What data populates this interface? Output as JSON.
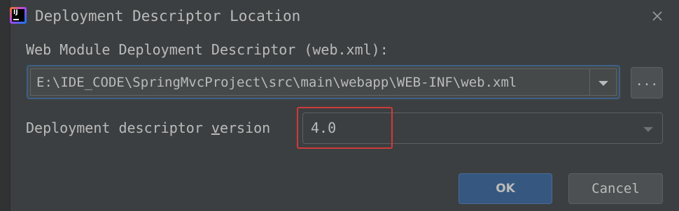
{
  "window": {
    "title": "Deployment Descriptor Location",
    "app_icon_text": "IJ"
  },
  "descriptor": {
    "label": "Web Module Deployment Descriptor (web.xml):",
    "path_value": "E:\\IDE_CODE\\SpringMvcProject\\src\\main\\webapp\\WEB-INF\\web.xml",
    "browse_label": "..."
  },
  "version": {
    "label_before": "Deployment descriptor ",
    "label_mnemonic": "v",
    "label_after": "ersion",
    "selected": "4.0"
  },
  "buttons": {
    "ok_label": "OK",
    "cancel_label": "Cancel"
  },
  "colors": {
    "background": "#3c3f41",
    "text": "#bbbbbb",
    "focus_border": "#3d6185",
    "default_button": "#365880",
    "highlight_annotation": "#cf3a3a"
  },
  "icons": {
    "app": "intellij-idea-icon",
    "close": "close-icon",
    "dropdown": "chevron-down-icon"
  }
}
